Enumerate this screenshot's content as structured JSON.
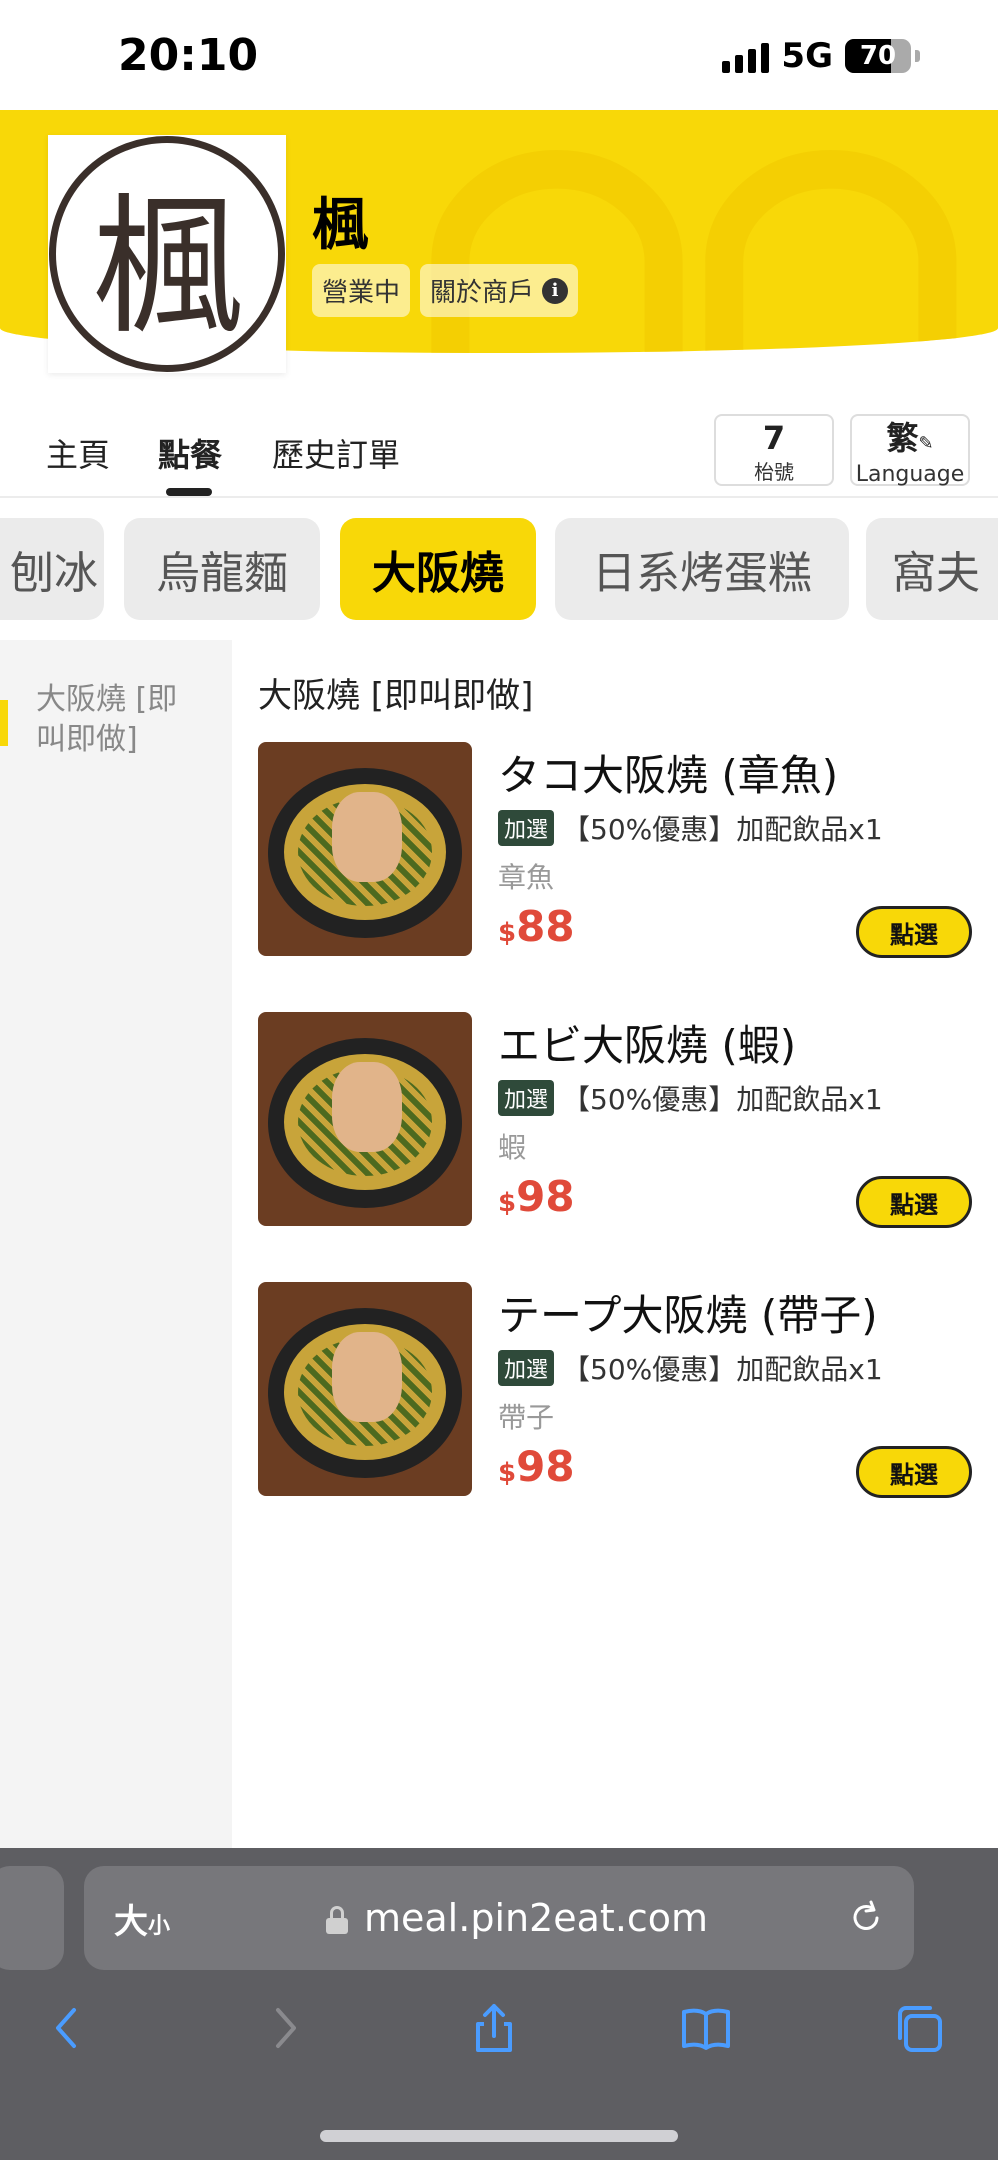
{
  "status": {
    "time": "20:10",
    "network": "5G",
    "battery": "70",
    "battery_level": 0.7
  },
  "shop": {
    "name": "楓",
    "logo_text": "楓",
    "open_status": "營業中",
    "about_label": "關於商戶",
    "info_symbol": "i"
  },
  "tabs": [
    {
      "label": "主頁"
    },
    {
      "label": "點餐"
    },
    {
      "label": "歷史訂單"
    }
  ],
  "table": {
    "number": "7",
    "label": "枱號"
  },
  "language": {
    "current": "繁",
    "label": "Language"
  },
  "categories": [
    {
      "label": "刨冰"
    },
    {
      "label": "烏龍麵"
    },
    {
      "label": "大阪燒"
    },
    {
      "label": "日系烤蛋糕"
    },
    {
      "label": "窩夫"
    }
  ],
  "sidebar": {
    "items": [
      {
        "label": "大阪燒 [即叫即做]"
      }
    ]
  },
  "section_title": "大阪燒 [即叫即做]",
  "items": [
    {
      "name": "タコ大阪燒 (章魚)",
      "addon_tag": "加選",
      "promo": "【50%優惠】加配飲品x1",
      "desc": "章魚",
      "currency": "$",
      "price": "88",
      "button": "點選"
    },
    {
      "name": "エビ大阪燒 (蝦)",
      "addon_tag": "加選",
      "promo": "【50%優惠】加配飲品x1",
      "desc": "蝦",
      "currency": "$",
      "price": "98",
      "button": "點選"
    },
    {
      "name": "テープ大阪燒 (帶子)",
      "addon_tag": "加選",
      "promo": "【50%優惠】加配飲品x1",
      "desc": "帶子",
      "currency": "$",
      "price": "98",
      "button": "點選"
    }
  ],
  "browser": {
    "aa_big": "大",
    "aa_small": "小",
    "url": "meal.pin2eat.com"
  },
  "icons": {
    "back": "chevron-left-icon",
    "forward": "chevron-right-icon",
    "share": "share-icon",
    "bookmarks": "book-icon",
    "tabs": "tabs-icon",
    "reload": "reload-icon",
    "lock": "lock-icon"
  },
  "colors": {
    "brand_yellow": "#f8d808",
    "price_red": "#e04a3a",
    "browser_chrome": "#5e5e62",
    "link_blue": "#4a9cff"
  }
}
